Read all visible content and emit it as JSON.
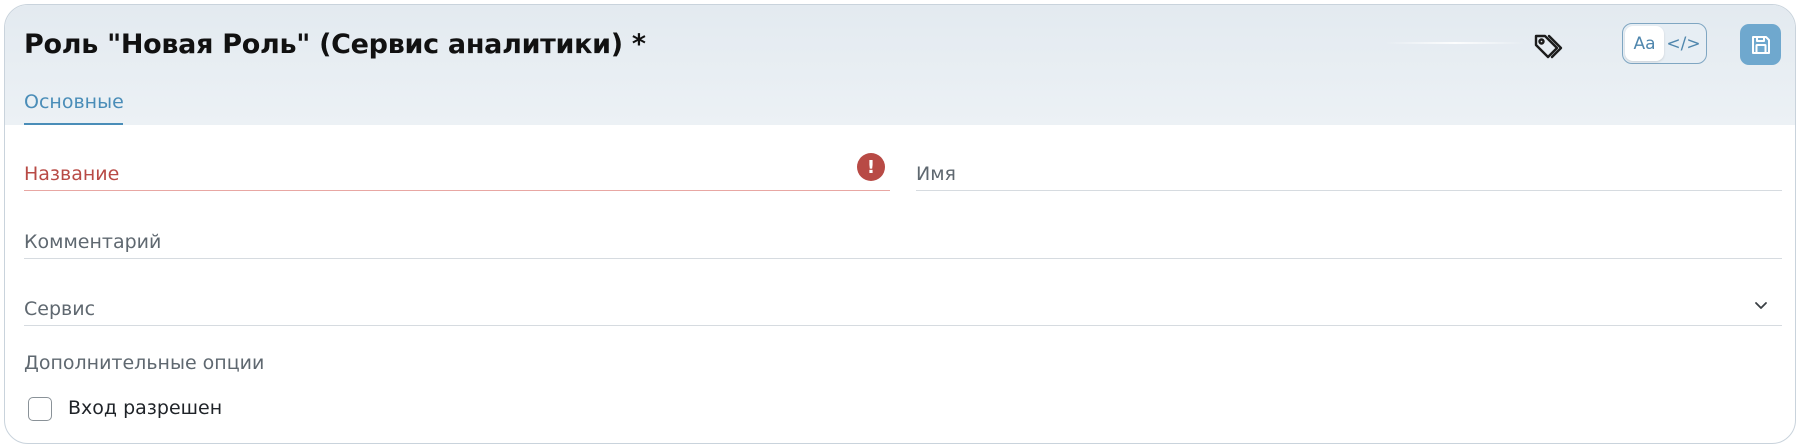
{
  "header": {
    "title": "Роль \"Новая Роль\" (Сервис аналитики) *",
    "tag_icon": "tag-icon",
    "mode_toggle": {
      "text_mode_label": "Aa",
      "code_mode_label": "</>",
      "active": "text"
    },
    "save_icon": "floppy-disk-icon"
  },
  "tabs": [
    {
      "label": "Основные",
      "active": true
    }
  ],
  "form": {
    "name_label": "Название",
    "name_value": "",
    "name_error": true,
    "name_error_icon": "exclamation-icon",
    "display_name_label": "Имя",
    "comment_label": "Комментарий",
    "service_label": "Сервис",
    "service_icon": "chevron-down-icon",
    "extra_options_label": "Дополнительные опции",
    "login_allowed_label": "Вход разрешен",
    "login_allowed_checked": false
  },
  "colors": {
    "accent": "#4a8db8",
    "error": "#b84a45",
    "save_button": "#6fa8ce",
    "header_bg": "#e3eaf0"
  }
}
